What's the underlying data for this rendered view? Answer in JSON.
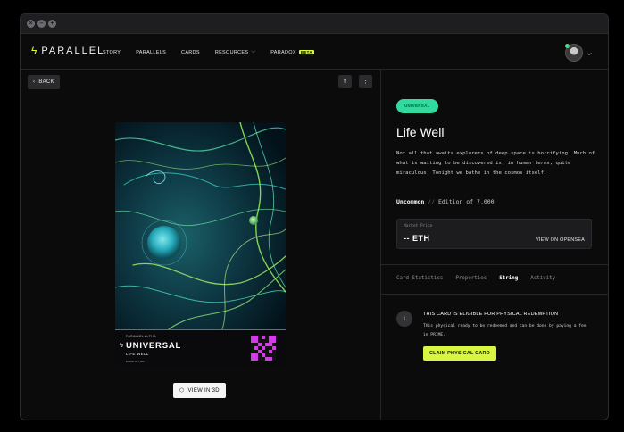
{
  "window": {
    "buttons": [
      "close",
      "minimize",
      "maximize"
    ]
  },
  "nav": {
    "logo_text": "PARALLEL",
    "links": [
      {
        "label": "STORY"
      },
      {
        "label": "PARALLELS"
      },
      {
        "label": "CARDS"
      },
      {
        "label": "RESOURCES",
        "has_dropdown": true
      },
      {
        "label": "PARADOX",
        "badge": "BETA"
      }
    ],
    "accent_color": "#d8f542"
  },
  "toolbar": {
    "back_label": "BACK",
    "share_icon": "share-icon",
    "more_icon": "more-vertical-icon"
  },
  "card": {
    "set_label": "PARALLEL ALPHA",
    "parallel": "UNIVERSAL",
    "name": "LIFE WELL",
    "edition_text": "Edition of 7,000",
    "frame_color": "#c72bd9"
  },
  "view3d_label": "VIEW IN 3D",
  "detail": {
    "badge": "UNIVERSAL",
    "badge_color": "#34d9a0",
    "title": "Life Well",
    "description": "Not all that awaits explorers of deep space is horrifying. Much of what is waiting to be discovered is, in human terms, quite miraculous. Tonight we bathe in the cosmos itself.",
    "rarity": "Uncommon",
    "separator": "//",
    "edition": "Edition of 7,000",
    "market_price_label": "Market Price",
    "market_price_value": "-- ETH",
    "opensea_link": "VIEW ON OPENSEA",
    "tabs": [
      {
        "label": "Card Statistics",
        "active": false
      },
      {
        "label": "Properties",
        "active": false
      },
      {
        "label": "String",
        "active": true
      },
      {
        "label": "Activity",
        "active": false
      }
    ],
    "redemption": {
      "title": "THIS CARD IS ELIGIBLE FOR PHYSICAL REDEMPTION",
      "description": "This physical ready to be redeemed and can be done by paying a fee in PRIME.",
      "button": "CLAIM PHYSICAL CARD"
    }
  }
}
